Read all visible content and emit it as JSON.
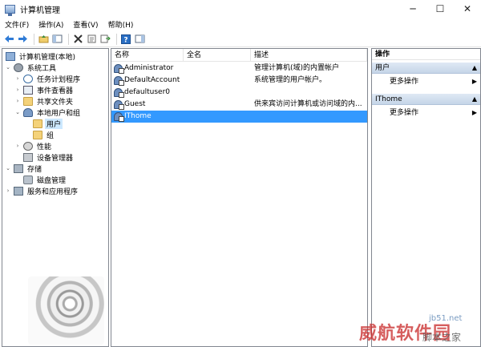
{
  "window": {
    "title": "计算机管理",
    "controls": {
      "minimize": "─",
      "maximize": "☐",
      "close": "✕"
    }
  },
  "menubar": {
    "items": [
      "文件(F)",
      "操作(A)",
      "查看(V)",
      "帮助(H)"
    ]
  },
  "toolbar": {
    "icons": [
      "back-arrow-icon",
      "forward-arrow-icon",
      "up-folder-icon",
      "show-hide-tree-icon",
      "delete-icon",
      "properties-icon",
      "export-list-icon",
      "help-icon",
      "show-hide-action-pane-icon"
    ]
  },
  "tree": {
    "items": [
      {
        "label": "计算机管理(本地)",
        "expander": "",
        "icon": "computer-icon",
        "indent": 0
      },
      {
        "label": "系统工具",
        "expander": "⌄",
        "icon": "tools-icon",
        "indent": 1
      },
      {
        "label": "任务计划程序",
        "expander": "›",
        "icon": "clock-icon",
        "indent": 2
      },
      {
        "label": "事件查看器",
        "expander": "›",
        "icon": "event-log-icon",
        "indent": 2
      },
      {
        "label": "共享文件夹",
        "expander": "›",
        "icon": "shared-folder-icon",
        "indent": 2
      },
      {
        "label": "本地用户和组",
        "expander": "⌄",
        "icon": "users-icon",
        "indent": 2
      },
      {
        "label": "用户",
        "expander": "",
        "icon": "folder-icon",
        "indent": 3,
        "selected": true
      },
      {
        "label": "组",
        "expander": "",
        "icon": "folder-icon",
        "indent": 3
      },
      {
        "label": "性能",
        "expander": "›",
        "icon": "performance-icon",
        "indent": 2
      },
      {
        "label": "设备管理器",
        "expander": "",
        "icon": "device-manager-icon",
        "indent": 2
      },
      {
        "label": "存储",
        "expander": "⌄",
        "icon": "storage-icon",
        "indent": 1
      },
      {
        "label": "磁盘管理",
        "expander": "",
        "icon": "disk-icon",
        "indent": 2
      },
      {
        "label": "服务和应用程序",
        "expander": "›",
        "icon": "services-icon",
        "indent": 1
      }
    ]
  },
  "list": {
    "columns": [
      "名称",
      "全名",
      "描述"
    ],
    "rows": [
      {
        "name": "Administrator",
        "fullname": "",
        "description": "管理计算机(域)的内置帐户"
      },
      {
        "name": "DefaultAccount",
        "fullname": "",
        "description": "系统管理的用户帐户。"
      },
      {
        "name": "defaultuser0",
        "fullname": "",
        "description": ""
      },
      {
        "name": "Guest",
        "fullname": "",
        "description": "供来宾访问计算机或访问域的内..."
      },
      {
        "name": "IThome",
        "fullname": "",
        "description": "",
        "selected": true
      }
    ]
  },
  "actions": {
    "title": "操作",
    "sections": [
      {
        "header": "用户",
        "item": "更多操作"
      },
      {
        "header": "IThome",
        "item": "更多操作"
      }
    ],
    "arrow": "▲",
    "more_arrow": "▶"
  },
  "watermark": {
    "site": "jb51.net",
    "big": "威航软件园",
    "small": "脚本之家"
  },
  "colors": {
    "selection": "#3399ff",
    "tree_selection": "#cce8ff",
    "section_header": "#c5d5e8"
  }
}
